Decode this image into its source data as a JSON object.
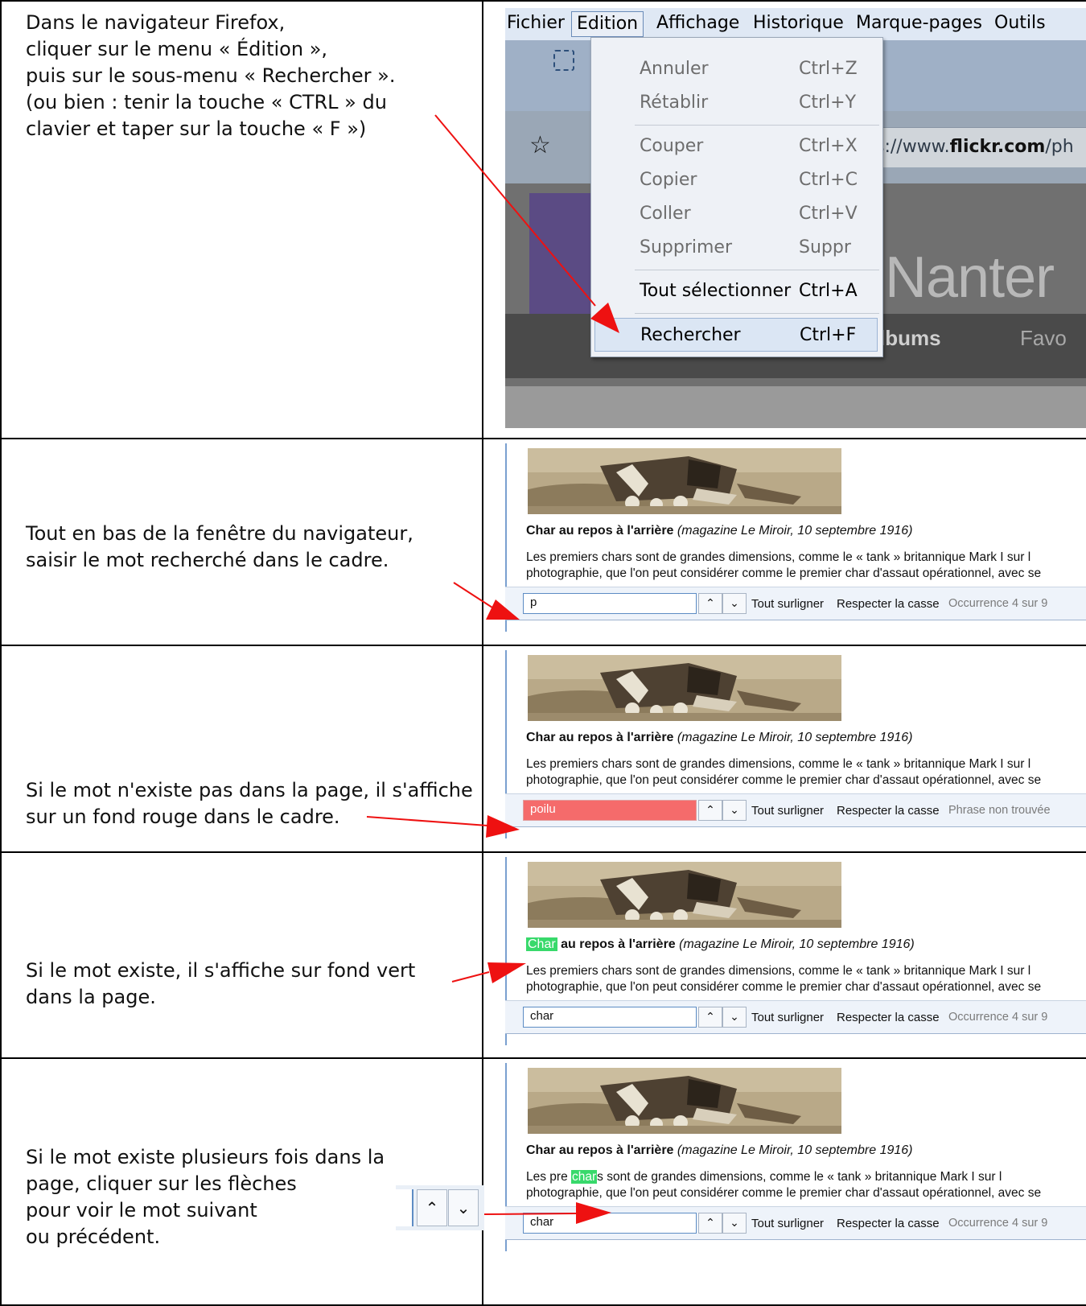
{
  "rows": [
    {
      "lines": [
        "Dans le navigateur Firefox,",
        "",
        "cliquer sur le menu « Édition »,",
        "puis sur le sous-menu « Rechercher ».",
        "",
        "",
        "",
        "(ou bien : tenir la touche « CTRL » du",
        "clavier et taper sur la touche « F »)"
      ]
    },
    {
      "lines": [
        "Tout en bas de la fenêtre du navigateur,",
        "saisir le mot recherché dans le cadre."
      ]
    },
    {
      "lines": [
        "Si le mot n'existe pas dans la page, il s'affiche",
        "sur un fond rouge dans le cadre."
      ]
    },
    {
      "lines": [
        "Si le mot existe, il s'affiche sur fond vert",
        "dans la page."
      ]
    },
    {
      "lines": [
        "Si le mot existe plusieurs fois dans la",
        "page, cliquer sur les flèches",
        "pour voir le mot suivant",
        "ou précédent."
      ]
    }
  ],
  "firefox": {
    "menubar": [
      "Fichier",
      "Edition",
      "Affichage",
      "Historique",
      "Marque-pages",
      "Outils"
    ],
    "url_prefix": "s://www.",
    "url_bold": "flickr.com",
    "url_suffix": "/ph",
    "page_title": "Nanter",
    "albums": "lbums",
    "favo": "Favo",
    "menu_items": [
      {
        "label": "Annuler",
        "shortcut": "Ctrl+Z"
      },
      {
        "label": "Rétablir",
        "shortcut": "Ctrl+Y"
      },
      {
        "label": "Couper",
        "shortcut": "Ctrl+X"
      },
      {
        "label": "Copier",
        "shortcut": "Ctrl+C"
      },
      {
        "label": "Coller",
        "shortcut": "Ctrl+V"
      },
      {
        "label": "Supprimer",
        "shortcut": "Suppr"
      },
      {
        "label": "Tout sélectionner",
        "shortcut": "Ctrl+A"
      },
      {
        "label": "Rechercher",
        "shortcut": "Ctrl+F"
      }
    ]
  },
  "page": {
    "caption_bold": "Char au repos à l'arrière",
    "caption_bold_rest": "au repos à l'arrière",
    "caption_highlight": "Char",
    "caption_italic": "(magazine Le Miroir, 10 septembre 1916)",
    "para_line1": "Les premiers chars sont de grandes dimensions, comme le « tank » britannique Mark I sur l",
    "para_line1_prefix": "Les pre",
    "para_line1_mid": " ",
    "para_line1_hl": "char",
    "para_line1_rest": "s sont de grandes dimensions, comme le « tank » britannique Mark I sur l",
    "para_line2": "photographie, que l'on peut considérer comme le premier char d'assaut opérationnel, avec se"
  },
  "findbar": {
    "highlight_all": "Tout surligner",
    "match_case": "Respecter la casse",
    "up_glyph": "^",
    "down_glyph": "v",
    "panels": [
      {
        "value": "p",
        "status": "Occurrence 4 sur 9"
      },
      {
        "value": "poilu",
        "status": "Phrase non trouvée"
      },
      {
        "value": "char",
        "status": "Occurrence 4 sur 9"
      },
      {
        "value": "char",
        "status": "Occurrence 4 sur 9"
      }
    ]
  },
  "colors": {
    "not_found_bg": "#f56b6b",
    "found_highlight": "#38d96b",
    "arrow_red": "#ee1111"
  }
}
